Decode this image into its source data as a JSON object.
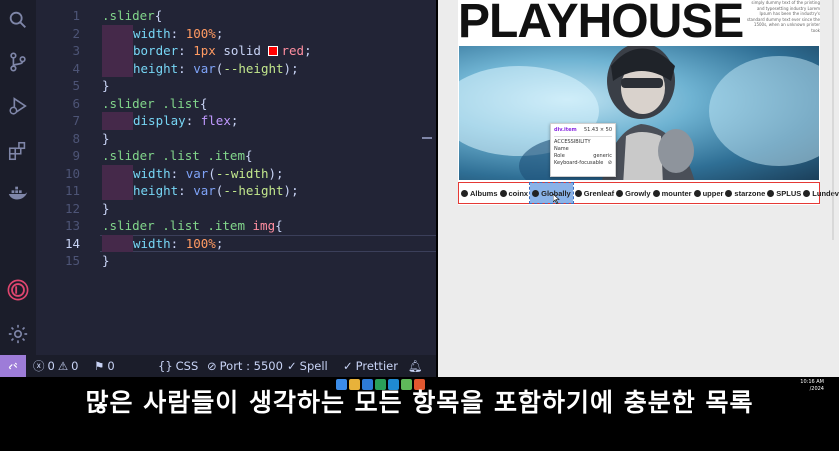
{
  "editor": {
    "lines": [
      {
        "n": "1",
        "segs": [
          [
            "t-sel",
            ".slider"
          ],
          [
            "t-pun",
            "{"
          ]
        ]
      },
      {
        "n": "2",
        "indent": true,
        "segs": [
          [
            "t-prop",
            "width"
          ],
          [
            "t-pun",
            ": "
          ],
          [
            "t-num",
            "100%"
          ],
          [
            "t-pun",
            ";"
          ]
        ]
      },
      {
        "n": "3",
        "indent": true,
        "segs": [
          [
            "t-prop",
            "border"
          ],
          [
            "t-pun",
            ": "
          ],
          [
            "t-num",
            "1px"
          ],
          [
            "t-str",
            " solid "
          ],
          [
            "swatch",
            ""
          ],
          [
            "t-red",
            "red"
          ],
          [
            "t-pun",
            ";"
          ]
        ]
      },
      {
        "n": "4",
        "indent": true,
        "segs": [
          [
            "t-prop",
            "height"
          ],
          [
            "t-pun",
            ": "
          ],
          [
            "t-fn",
            "var"
          ],
          [
            "t-pun",
            "("
          ],
          [
            "t-var",
            "--height"
          ],
          [
            "t-pun",
            ");"
          ]
        ]
      },
      {
        "n": "5",
        "segs": [
          [
            "t-pun",
            "}"
          ]
        ]
      },
      {
        "n": "6",
        "segs": [
          [
            "t-sel",
            ".slider .list"
          ],
          [
            "t-pun",
            "{"
          ]
        ]
      },
      {
        "n": "7",
        "indent": true,
        "segs": [
          [
            "t-prop",
            "display"
          ],
          [
            "t-pun",
            ": "
          ],
          [
            "t-kw",
            "flex"
          ],
          [
            "t-pun",
            ";"
          ]
        ]
      },
      {
        "n": "8",
        "segs": [
          [
            "t-pun",
            "}"
          ]
        ]
      },
      {
        "n": "9",
        "segs": [
          [
            "t-sel",
            ".slider .list .item"
          ],
          [
            "t-pun",
            "{"
          ]
        ]
      },
      {
        "n": "10",
        "indent": true,
        "segs": [
          [
            "t-prop",
            "width"
          ],
          [
            "t-pun",
            ": "
          ],
          [
            "t-fn",
            "var"
          ],
          [
            "t-pun",
            "("
          ],
          [
            "t-var",
            "--width"
          ],
          [
            "t-pun",
            ");"
          ]
        ]
      },
      {
        "n": "11",
        "indent": true,
        "segs": [
          [
            "t-prop",
            "height"
          ],
          [
            "t-pun",
            ": "
          ],
          [
            "t-fn",
            "var"
          ],
          [
            "t-pun",
            "("
          ],
          [
            "t-var",
            "--height"
          ],
          [
            "t-pun",
            ");"
          ]
        ]
      },
      {
        "n": "12",
        "segs": [
          [
            "t-pun",
            "}"
          ]
        ]
      },
      {
        "n": "13",
        "segs": [
          [
            "t-sel",
            ".slider .list .item "
          ],
          [
            "t-red",
            "img"
          ],
          [
            "t-pun",
            "{"
          ]
        ]
      },
      {
        "n": "14",
        "indent": true,
        "active": true,
        "segs": [
          [
            "t-prop",
            "width"
          ],
          [
            "t-pun",
            ": "
          ],
          [
            "t-num",
            "100%"
          ],
          [
            "t-pun",
            ";"
          ]
        ]
      },
      {
        "n": "15",
        "segs": [
          [
            "t-pun",
            "}"
          ]
        ]
      }
    ]
  },
  "activity_bar": {
    "icons": [
      "search-icon",
      "source-control-icon",
      "run-debug-icon",
      "extensions-icon",
      "docker-icon",
      "account-logo-icon",
      "settings-icon"
    ]
  },
  "statusbar": {
    "errors": "0",
    "warnings": "0",
    "info": "0",
    "language": "CSS",
    "port": "Port : 5500",
    "spell": "Spell",
    "prettier": "Prettier"
  },
  "browser": {
    "brand": "PLAYHOUSE",
    "blurb": "simply dummy text of the printing and typesetting industry Lorem Ipsum has been the industry's standard dummy text ever since the 1500s, when an unknown printer took",
    "logos": [
      "Albums",
      "coinx",
      "Globally",
      "Grenleaf",
      "Growly",
      "mounter",
      "upper",
      "starzone",
      "SPLUS",
      "Lundev"
    ],
    "highlighted_logo_index": 2,
    "tooltip": {
      "tag": "div.item",
      "size": "51.43 × 50",
      "section": "ACCESSIBILITY",
      "rows": [
        {
          "k": "Name",
          "v": ""
        },
        {
          "k": "Role",
          "v": "generic"
        },
        {
          "k": "Keyboard-focusable",
          "v": "⊘"
        }
      ]
    }
  },
  "subtitle": {
    "text": "많은 사람들이 생각하는 모든 항목을 포함하기에 충분한 목록"
  },
  "tray": {
    "time": "10:16 AM",
    "date": "/2024"
  },
  "colors": {
    "editor_bg": "#222436",
    "activity_bg": "#1b1d2a",
    "remote_accent": "#9d7cd8",
    "indent_highlight": "#45294a",
    "logo_border": "#e53935"
  }
}
